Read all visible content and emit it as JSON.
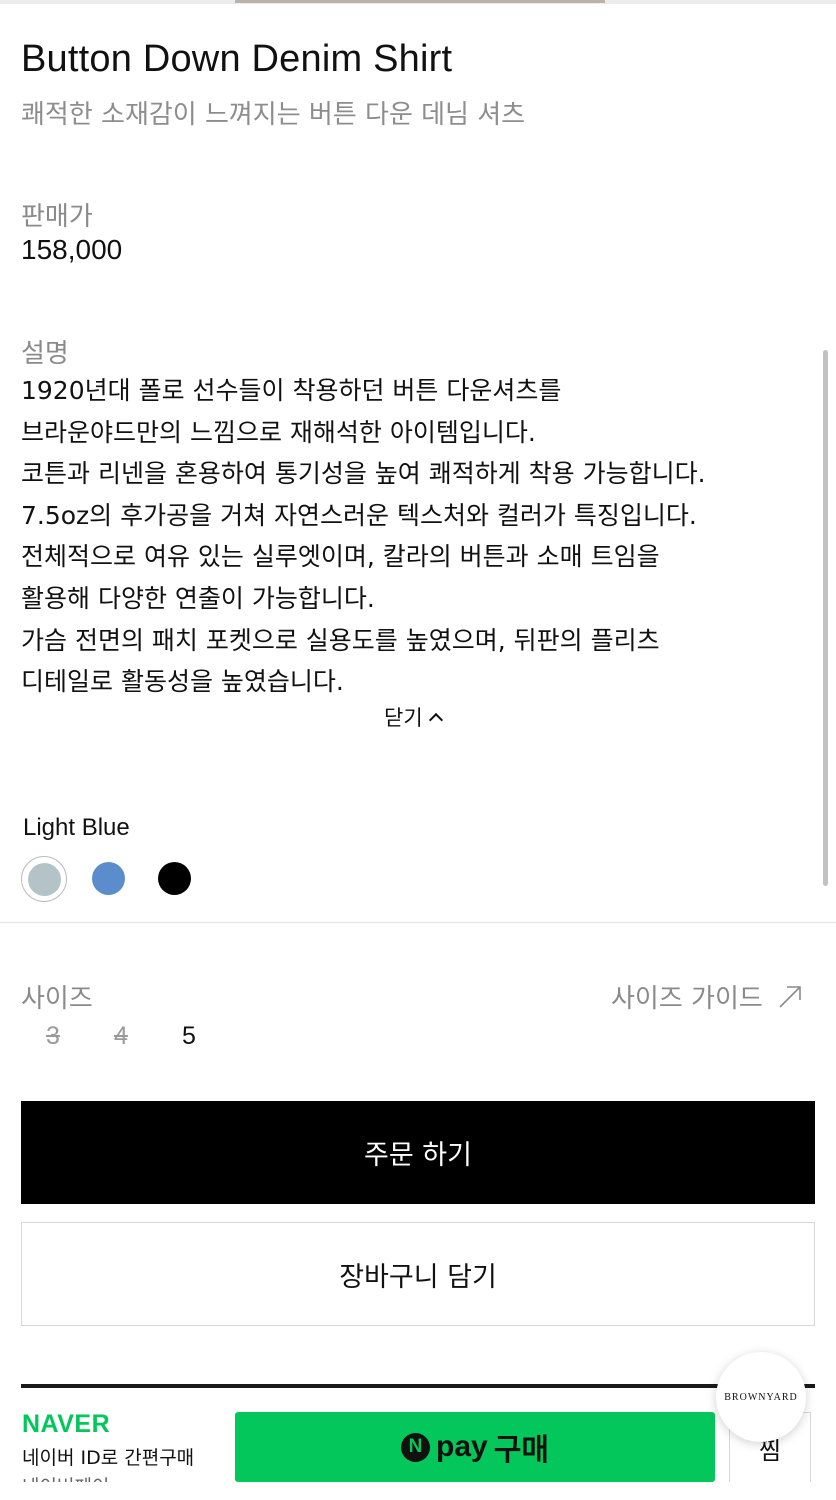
{
  "product": {
    "title": "Button Down Denim Shirt",
    "subtitle": "쾌적한 소재감이 느껴지는 버튼 다운 데님 셔츠",
    "price_label": "판매가",
    "price": "158,000",
    "description_label": "설명",
    "description_lines": [
      "1920년대 폴로 선수들이 착용하던 버튼 다운셔츠를",
      "브라운야드만의 느낌으로 재해석한 아이템입니다.",
      "코튼과 리넨을 혼용하여 통기성을 높여 쾌적하게 착용 가능합니다.",
      "7.5oz의 후가공을 거쳐 자연스러운 텍스처와 컬러가 특징입니다.",
      "전체적으로 여유 있는 실루엣이며, 칼라의 버튼과 소매 트임을",
      "활용해 다양한 연출이 가능합니다.",
      "가슴 전면의 패치 포켓으로 실용도를 높였으며, 뒤판의 플리츠",
      "디테일로 활동성을 높였습니다."
    ],
    "close_label": "닫기"
  },
  "colors": {
    "selected_name": "Light Blue",
    "options": [
      {
        "name": "Light Blue",
        "hex": "#b3c3c8",
        "selected": true
      },
      {
        "name": "Blue",
        "hex": "#5b8ccb",
        "selected": false
      },
      {
        "name": "Black",
        "hex": "#000000",
        "selected": false
      }
    ]
  },
  "size": {
    "label": "사이즈",
    "guide_label": "사이즈 가이드",
    "options": [
      {
        "value": "3",
        "available": false
      },
      {
        "value": "4",
        "available": false
      },
      {
        "value": "5",
        "available": true
      }
    ]
  },
  "actions": {
    "order_label": "주문 하기",
    "cart_label": "장바구니 담기"
  },
  "naver": {
    "logo": "NAVER",
    "subtext": "네이버 ID로 간편구매",
    "subtext2": "네이버페이",
    "npay_n": "N",
    "npay_pay": "pay",
    "npay_buy": "구매",
    "wish_label": "찜"
  },
  "brand_badge": "BROWNYARD",
  "accent_colors": {
    "naver_green": "#03c75a",
    "order_button": "#000000"
  }
}
